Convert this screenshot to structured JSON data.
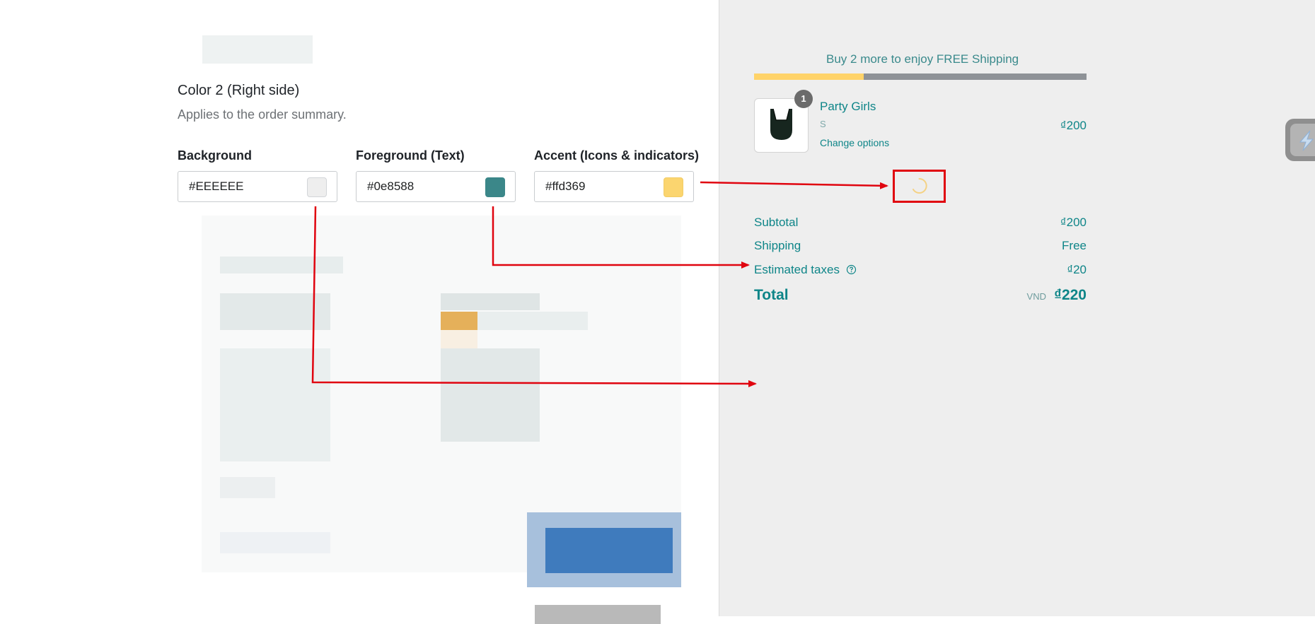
{
  "settings": {
    "section_title": "Color 2 (Right side)",
    "section_subtitle": "Applies to the order summary.",
    "fields": [
      {
        "label": "Background",
        "value": "#EEEEEE",
        "swatch_color": "#EEEEEE"
      },
      {
        "label": "Foreground (Text)",
        "value": "#0e8588",
        "swatch_color": "#3b8789"
      },
      {
        "label": "Accent (Icons & indicators)",
        "value": "#ffd369",
        "swatch_color": "#fbd56f"
      }
    ]
  },
  "summary": {
    "shipping_message": "Buy 2 more to enjoy FREE Shipping",
    "progress_fraction": 0.33,
    "product": {
      "quantity_badge": "1",
      "name": "Party Girls",
      "variant": "S",
      "change_link": "Change options",
      "price": "₫200"
    },
    "rows": [
      {
        "label": "Subtotal",
        "value": "₫200"
      },
      {
        "label": "Shipping",
        "value": "Free"
      },
      {
        "label": "Estimated taxes",
        "value": "₫20"
      }
    ],
    "total": {
      "label": "Total",
      "currency": "VND",
      "value": "₫220"
    }
  },
  "colors": {
    "panel_background": "#EEEEEE",
    "foreground": "#0e8588",
    "accent": "#ffd369",
    "annotation_red": "#e0040f"
  },
  "icons": {
    "tax_info": "question-circle-icon",
    "loading": "spinner-icon",
    "side_widget": "lightning-icon"
  }
}
